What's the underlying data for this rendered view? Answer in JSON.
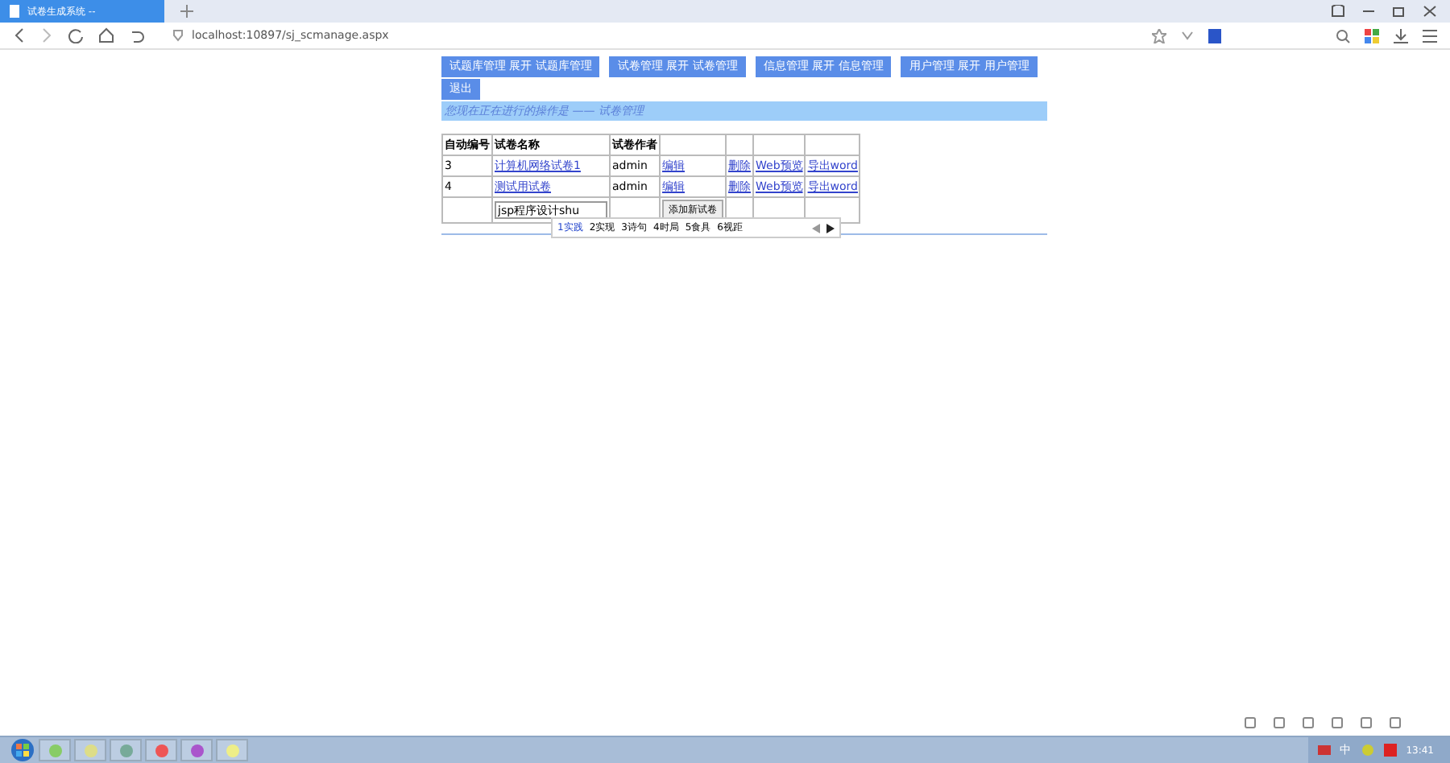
{
  "browser": {
    "tab_title": "试卷生成系统 --",
    "address": "localhost:10897/sj_scmanage.aspx"
  },
  "menu": [
    {
      "label": "试题库管理 展开 试题库管理"
    },
    {
      "label": "试卷管理 展开 试卷管理"
    },
    {
      "label": "信息管理 展开 信息管理"
    },
    {
      "label": "用户管理 展开 用户管理"
    },
    {
      "label": "退出"
    }
  ],
  "breadcrumb": "您现在正在进行的操作是 —— 试卷管理",
  "table": {
    "columns": [
      "自动编号",
      "试卷名称",
      "试卷作者"
    ],
    "rows": [
      {
        "id": "3",
        "name": "计算机网络试卷1",
        "author": "admin",
        "actions": [
          "编辑",
          "删除",
          "Web预览",
          "导出word"
        ]
      },
      {
        "id": "4",
        "name": "测试用试卷",
        "author": "admin",
        "actions": [
          "编辑",
          "删除",
          "Web预览",
          "导出word"
        ]
      }
    ],
    "new_row": {
      "value": "jsp程序设计shu",
      "button": "添加新试卷"
    }
  },
  "ime": {
    "candidates": [
      "1实践",
      "2实现",
      "3诗句",
      "4时局",
      "5食具",
      "6视距"
    ]
  },
  "taskbar": {
    "ime_label": "中",
    "clock": "13:41"
  }
}
